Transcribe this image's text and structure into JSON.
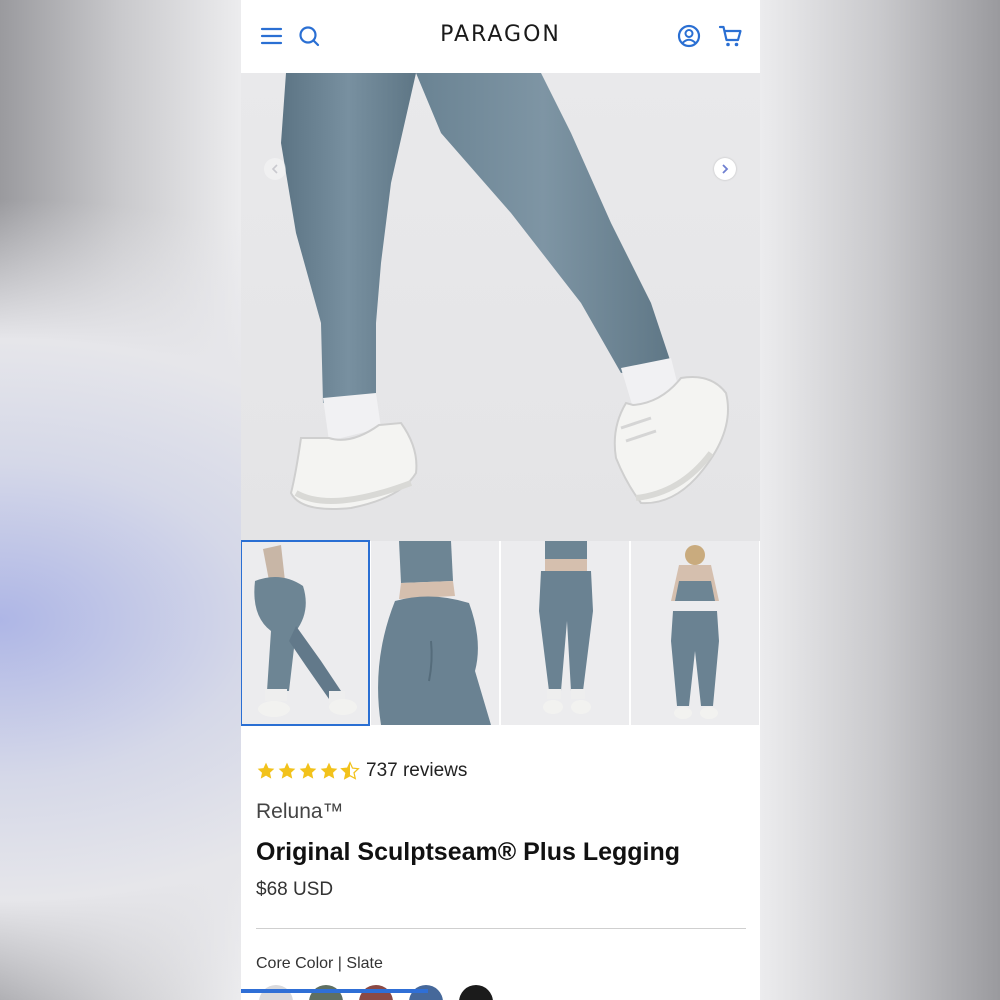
{
  "header": {
    "brand": "PARAGON",
    "icons": [
      "menu-icon",
      "search-icon",
      "account-icon",
      "cart-icon"
    ],
    "accent_color": "#2a6fd3"
  },
  "gallery": {
    "thumbnails": [
      "back-view-walking",
      "back-close-up",
      "front-full",
      "back-full"
    ],
    "active_thumbnail": 0
  },
  "product": {
    "rating_value": 4.5,
    "reviews_text": "737 reviews",
    "vendor": "Reluna™",
    "title": "Original Sculptseam® Plus Legging",
    "price": "$68 USD",
    "color_label": "Core Color | Slate",
    "swatches": [
      "#d9d9dc",
      "#5f6f62",
      "#8b4a45",
      "#46689a",
      "#1b1b1b"
    ]
  },
  "scroll": {
    "progress": 0.36
  }
}
